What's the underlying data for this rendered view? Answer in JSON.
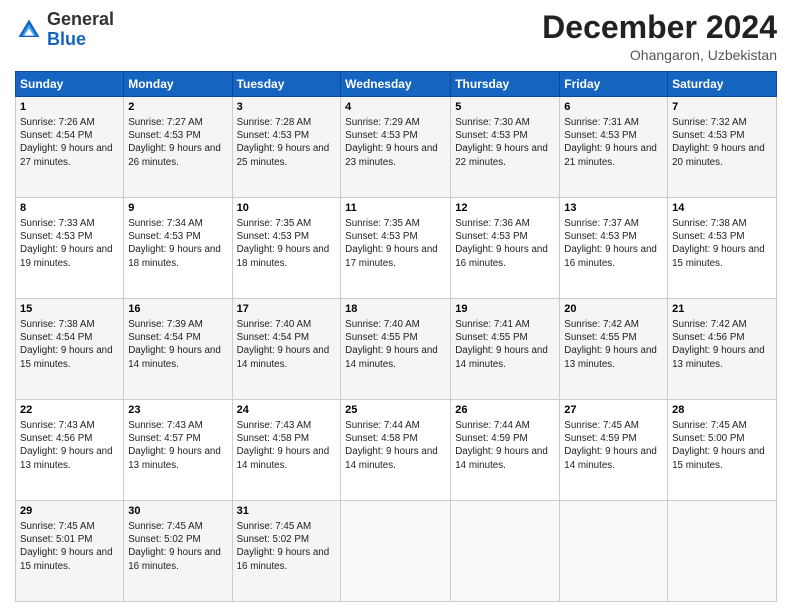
{
  "logo": {
    "general": "General",
    "blue": "Blue"
  },
  "title": "December 2024",
  "location": "Ohangaron, Uzbekistan",
  "days_header": [
    "Sunday",
    "Monday",
    "Tuesday",
    "Wednesday",
    "Thursday",
    "Friday",
    "Saturday"
  ],
  "weeks": [
    [
      {
        "day": "1",
        "sunrise": "7:26 AM",
        "sunset": "4:54 PM",
        "daylight": "9 hours and 27 minutes."
      },
      {
        "day": "2",
        "sunrise": "7:27 AM",
        "sunset": "4:53 PM",
        "daylight": "9 hours and 26 minutes."
      },
      {
        "day": "3",
        "sunrise": "7:28 AM",
        "sunset": "4:53 PM",
        "daylight": "9 hours and 25 minutes."
      },
      {
        "day": "4",
        "sunrise": "7:29 AM",
        "sunset": "4:53 PM",
        "daylight": "9 hours and 23 minutes."
      },
      {
        "day": "5",
        "sunrise": "7:30 AM",
        "sunset": "4:53 PM",
        "daylight": "9 hours and 22 minutes."
      },
      {
        "day": "6",
        "sunrise": "7:31 AM",
        "sunset": "4:53 PM",
        "daylight": "9 hours and 21 minutes."
      },
      {
        "day": "7",
        "sunrise": "7:32 AM",
        "sunset": "4:53 PM",
        "daylight": "9 hours and 20 minutes."
      }
    ],
    [
      {
        "day": "8",
        "sunrise": "7:33 AM",
        "sunset": "4:53 PM",
        "daylight": "9 hours and 19 minutes."
      },
      {
        "day": "9",
        "sunrise": "7:34 AM",
        "sunset": "4:53 PM",
        "daylight": "9 hours and 18 minutes."
      },
      {
        "day": "10",
        "sunrise": "7:35 AM",
        "sunset": "4:53 PM",
        "daylight": "9 hours and 18 minutes."
      },
      {
        "day": "11",
        "sunrise": "7:35 AM",
        "sunset": "4:53 PM",
        "daylight": "9 hours and 17 minutes."
      },
      {
        "day": "12",
        "sunrise": "7:36 AM",
        "sunset": "4:53 PM",
        "daylight": "9 hours and 16 minutes."
      },
      {
        "day": "13",
        "sunrise": "7:37 AM",
        "sunset": "4:53 PM",
        "daylight": "9 hours and 16 minutes."
      },
      {
        "day": "14",
        "sunrise": "7:38 AM",
        "sunset": "4:53 PM",
        "daylight": "9 hours and 15 minutes."
      }
    ],
    [
      {
        "day": "15",
        "sunrise": "7:38 AM",
        "sunset": "4:54 PM",
        "daylight": "9 hours and 15 minutes."
      },
      {
        "day": "16",
        "sunrise": "7:39 AM",
        "sunset": "4:54 PM",
        "daylight": "9 hours and 14 minutes."
      },
      {
        "day": "17",
        "sunrise": "7:40 AM",
        "sunset": "4:54 PM",
        "daylight": "9 hours and 14 minutes."
      },
      {
        "day": "18",
        "sunrise": "7:40 AM",
        "sunset": "4:55 PM",
        "daylight": "9 hours and 14 minutes."
      },
      {
        "day": "19",
        "sunrise": "7:41 AM",
        "sunset": "4:55 PM",
        "daylight": "9 hours and 14 minutes."
      },
      {
        "day": "20",
        "sunrise": "7:42 AM",
        "sunset": "4:55 PM",
        "daylight": "9 hours and 13 minutes."
      },
      {
        "day": "21",
        "sunrise": "7:42 AM",
        "sunset": "4:56 PM",
        "daylight": "9 hours and 13 minutes."
      }
    ],
    [
      {
        "day": "22",
        "sunrise": "7:43 AM",
        "sunset": "4:56 PM",
        "daylight": "9 hours and 13 minutes."
      },
      {
        "day": "23",
        "sunrise": "7:43 AM",
        "sunset": "4:57 PM",
        "daylight": "9 hours and 13 minutes."
      },
      {
        "day": "24",
        "sunrise": "7:43 AM",
        "sunset": "4:58 PM",
        "daylight": "9 hours and 14 minutes."
      },
      {
        "day": "25",
        "sunrise": "7:44 AM",
        "sunset": "4:58 PM",
        "daylight": "9 hours and 14 minutes."
      },
      {
        "day": "26",
        "sunrise": "7:44 AM",
        "sunset": "4:59 PM",
        "daylight": "9 hours and 14 minutes."
      },
      {
        "day": "27",
        "sunrise": "7:45 AM",
        "sunset": "4:59 PM",
        "daylight": "9 hours and 14 minutes."
      },
      {
        "day": "28",
        "sunrise": "7:45 AM",
        "sunset": "5:00 PM",
        "daylight": "9 hours and 15 minutes."
      }
    ],
    [
      {
        "day": "29",
        "sunrise": "7:45 AM",
        "sunset": "5:01 PM",
        "daylight": "9 hours and 15 minutes."
      },
      {
        "day": "30",
        "sunrise": "7:45 AM",
        "sunset": "5:02 PM",
        "daylight": "9 hours and 16 minutes."
      },
      {
        "day": "31",
        "sunrise": "7:45 AM",
        "sunset": "5:02 PM",
        "daylight": "9 hours and 16 minutes."
      },
      null,
      null,
      null,
      null
    ]
  ],
  "labels": {
    "sunrise": "Sunrise:",
    "sunset": "Sunset:",
    "daylight": "Daylight:"
  }
}
